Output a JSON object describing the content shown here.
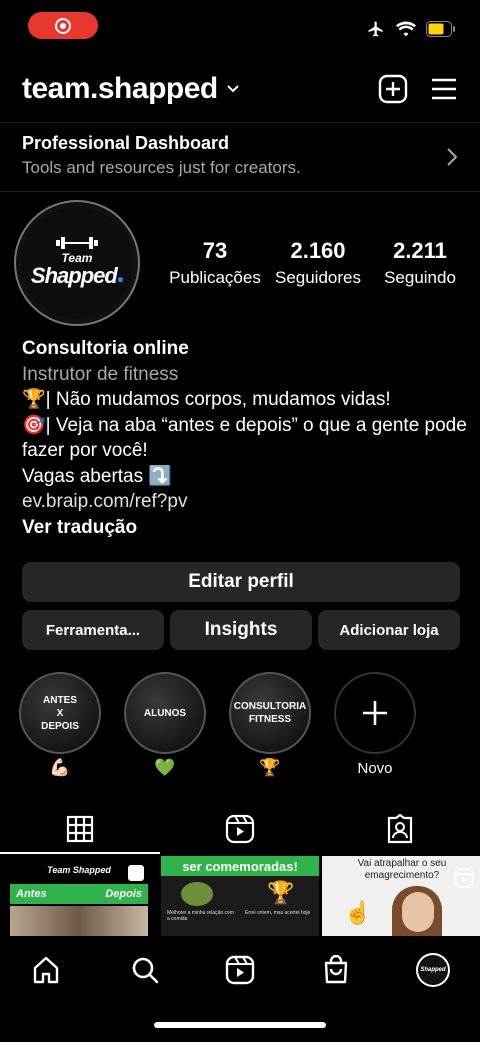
{
  "header": {
    "username": "team.shapped"
  },
  "dashboard": {
    "title": "Professional Dashboard",
    "subtitle": "Tools and resources just for creators."
  },
  "profile": {
    "logo_team": "Team",
    "logo_brand": "Shapped",
    "stats": [
      {
        "value": "73",
        "label": "Publicações"
      },
      {
        "value": "2.160",
        "label": "Seguidores"
      },
      {
        "value": "2.211",
        "label": "Seguindo"
      }
    ]
  },
  "bio": {
    "name": "Consultoria online",
    "category": "Instrutor de fitness",
    "line1": "🏆| Não mudamos corpos, mudamos vidas!",
    "line2": "🎯| Veja na aba “antes e depois” o que a gente pode fazer por você!",
    "line3": "Vagas abertas ⤵️",
    "link": "ev.braip.com/ref?pv",
    "translate": "Ver tradução"
  },
  "buttons": {
    "edit": "Editar perfil",
    "tools": "Ferramenta...",
    "insights": "Insights",
    "shop": "Adicionar loja"
  },
  "highlights": [
    {
      "line1": "ANTES",
      "line2": "X",
      "line3": "DEPOIS",
      "emoji": "💪🏻"
    },
    {
      "line1": "ALUNOS",
      "line2": "",
      "line3": "",
      "emoji": "💚"
    },
    {
      "line1": "CONSULTORIA",
      "line2": "FITNESS",
      "line3": "",
      "emoji": "🏆"
    },
    {
      "label": "Novo"
    }
  ],
  "posts": {
    "p1_brand": "Team Shapped",
    "p1_left": "Antes",
    "p1_right": "Depois",
    "p2_banner": "ser comemoradas!",
    "p2_sub_left": "Melhorei a minha relação com a comida",
    "p2_sub_right": "Errei ontem, mas acertei hoje",
    "p3_text": "Vai atrapalhar o seu emagrecimento?"
  },
  "nav": {
    "avatar_text": "Shapped"
  },
  "colors": {
    "record": "#e8372f",
    "button_bg": "#262626",
    "accent_green": "#2fb34a"
  }
}
